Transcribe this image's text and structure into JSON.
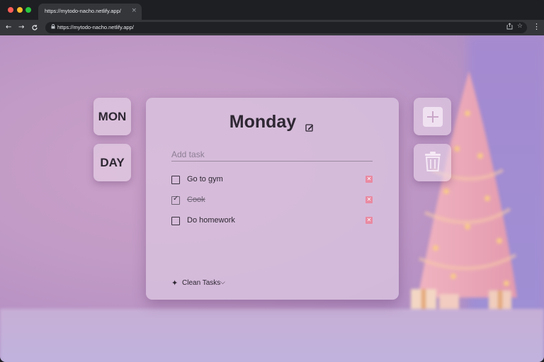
{
  "browser": {
    "tab_title": "https://mytodo-nacho.netlify.app/",
    "tab_close": "×",
    "url": "https://mytodo-nacho.netlify.app/",
    "nav": {
      "back": "←",
      "forward": "→",
      "reload": "C",
      "menu": "⋮",
      "share": "⇪",
      "star": "☆",
      "lock": "🔒"
    }
  },
  "side": {
    "mon_label": "MON",
    "day_label": "DAY"
  },
  "card": {
    "title": "Monday",
    "add_placeholder": "Add task",
    "tasks": [
      {
        "label": "Go to gym",
        "done": false
      },
      {
        "label": "Cook",
        "done": true
      },
      {
        "label": "Do homework",
        "done": false
      }
    ],
    "clean_label": "Clean Tasks",
    "clean_chevron": "⌵",
    "sparkle": "✦"
  },
  "colors": {
    "accent": "#e98aa2",
    "text": "#2e2733",
    "card": "#dcc8e2"
  }
}
